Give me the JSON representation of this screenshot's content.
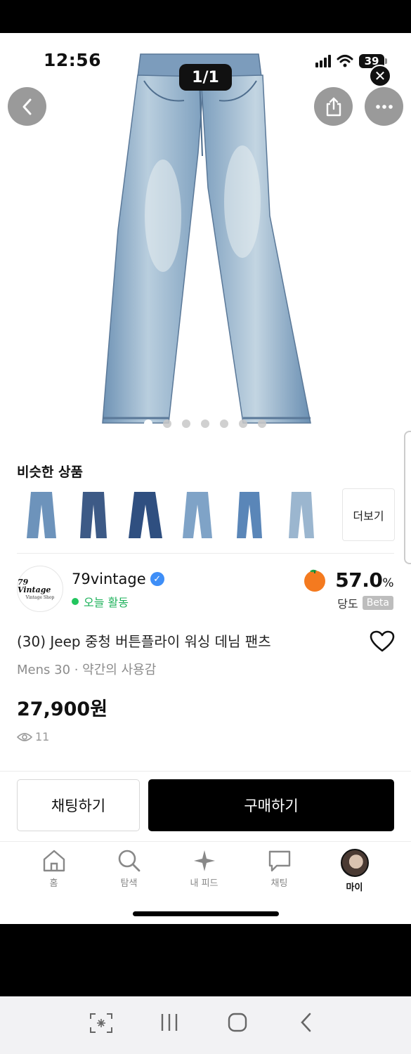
{
  "status_bar": {
    "time": "12:56",
    "battery": "39"
  },
  "gallery": {
    "counter": "1/1",
    "close_symbol": "✕"
  },
  "similar": {
    "title": "비슷한 상품",
    "more_label": "더보기"
  },
  "seller": {
    "name": "79vintage",
    "logo_line1": "79 Vintage",
    "logo_line2": "Vintage Shop",
    "activity": "오늘 활동",
    "sweetness_value": "57.0",
    "sweetness_unit": "%",
    "sweetness_label": "당도",
    "beta_badge": "Beta"
  },
  "product": {
    "title": "(30) Jeep 중청 버튼플라이 워싱 데님 팬츠",
    "subtitle": "Mens 30 · 약간의 사용감",
    "price": "27,900원",
    "views": "11"
  },
  "actions": {
    "chat_label": "채팅하기",
    "buy_label": "구매하기"
  },
  "tabs": [
    {
      "label": "홈",
      "icon": "home-icon"
    },
    {
      "label": "탐색",
      "icon": "search-icon"
    },
    {
      "label": "내 피드",
      "icon": "sparkle-icon"
    },
    {
      "label": "채팅",
      "icon": "chat-bubble-icon"
    },
    {
      "label": "마이",
      "icon": "profile-avatar"
    }
  ],
  "colors": {
    "accent_green": "#22c55e",
    "verified_blue": "#3e8ef7",
    "denim": "#8fb0cc"
  }
}
